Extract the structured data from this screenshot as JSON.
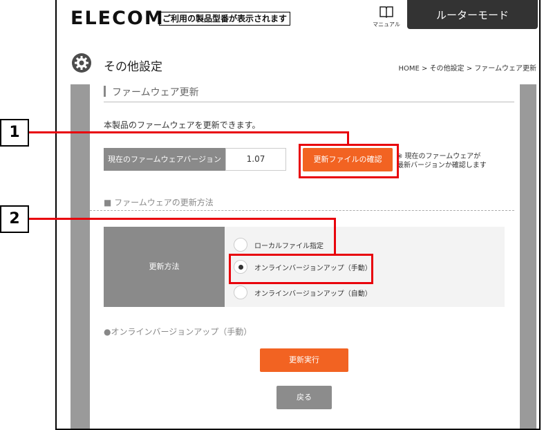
{
  "header": {
    "logo": "ELECOM",
    "tagline": "ご利用の製品型番が表示されます",
    "manual_label": "マニュアル",
    "mode_label": "ルーターモード"
  },
  "page": {
    "title": "その他設定",
    "breadcrumb": "HOME > その他設定 > ファームウェア更新"
  },
  "firmware": {
    "section_title": "ファームウェア更新",
    "description": "本製品のファームウェアを更新できます。",
    "version_label": "現在のファームウェアバージョン",
    "version_value": "1.07",
    "check_button": "更新ファイルの確認",
    "note_line1": "※ 現在のファームウェアが",
    "note_line2": "最新バージョンか確認します"
  },
  "update_method": {
    "section_title": "■ ファームウェアの更新方法",
    "label": "更新方法",
    "options": [
      {
        "label": "ローカルファイル指定",
        "selected": false
      },
      {
        "label": "オンラインバージョンアップ（手動）",
        "selected": true
      },
      {
        "label": "オンラインバージョンアップ（自動）",
        "selected": false
      }
    ]
  },
  "online": {
    "title": "●オンラインバージョンアップ（手動）",
    "execute_button": "更新実行",
    "back_button": "戻る"
  },
  "callouts": [
    "1",
    "2"
  ],
  "colors": {
    "accent": "#f26322",
    "callout_red": "#e8000b",
    "header_dark": "#333333",
    "label_gray": "#8a8a8a"
  }
}
